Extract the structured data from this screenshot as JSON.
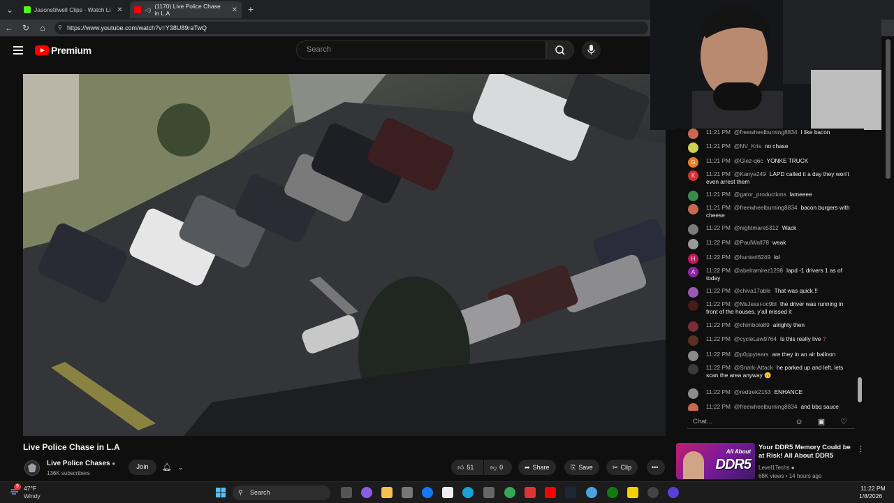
{
  "browser": {
    "tabs": [
      {
        "label": "Jasonstilwell Clips - Watch Li",
        "color": "#53fc18"
      },
      {
        "label": "(1170) Live Police Chase in L.A",
        "color": "#ff0000"
      }
    ],
    "new_tab": "+",
    "url": "https://www.youtube.com/watch?v=Y38U89raTwQ"
  },
  "youtube": {
    "logo_text": "Premium",
    "search_placeholder": "Search"
  },
  "video": {
    "title": "Live Police Chase in L.A",
    "channel": "Live Police Chases",
    "subscribers": "136K subscribers",
    "join_label": "Join",
    "likes": "51",
    "dislikes": "0",
    "share_label": "Share",
    "save_label": "Save",
    "clip_label": "Clip"
  },
  "chat": {
    "messages": [
      {
        "time": "11:21 PM",
        "author": "@freewheelburning8834",
        "text": "I like bacon",
        "avatar_color": "#c7684f"
      },
      {
        "time": "11:21 PM",
        "author": "@NV_Kris",
        "text": "no chase",
        "avatar_color": "#cbd44b"
      },
      {
        "time": "11:21 PM",
        "author": "@Glez-q6c",
        "text": "YONKE TRUCK",
        "avatar_color": "#e67e22",
        "initial": "G"
      },
      {
        "time": "11:21 PM",
        "author": "@Kanye249",
        "text": "LAPD called it a day they won't even arrest them",
        "avatar_color": "#d63031",
        "initial": "K"
      },
      {
        "time": "11:21 PM",
        "author": "@gator_productions",
        "text": "lameeee",
        "avatar_color": "#3c8a4a"
      },
      {
        "time": "11:21 PM",
        "author": "@freewheelburning8834",
        "text": "bacon burgers with cheese",
        "avatar_color": "#c7684f"
      },
      {
        "time": "11:22 PM",
        "author": "@nightmare5312",
        "text": "Wack",
        "avatar_color": "#7a7a7a"
      },
      {
        "time": "11:22 PM",
        "author": "@PaulWall78",
        "text": "weak",
        "avatar_color": "#9a9a9a"
      },
      {
        "time": "11:22 PM",
        "author": "@hunterl6249",
        "text": "lol",
        "avatar_color": "#c2185b",
        "initial": "H"
      },
      {
        "time": "11:22 PM",
        "author": "@abelramirez1298",
        "text": "lapd -1 drivers 1 as of today",
        "avatar_color": "#8e24aa",
        "initial": "A"
      },
      {
        "time": "11:22 PM",
        "author": "@chiva17able",
        "text": "That was quick.!!",
        "avatar_color": "#9b59b6"
      },
      {
        "time": "11:22 PM",
        "author": "@MsJessi-oc9bl",
        "text": "the driver was running in front of the houses. y'all missed it",
        "avatar_color": "#4a1a1a"
      },
      {
        "time": "11:22 PM",
        "author": "@chimbolo89",
        "text": "alrighty then",
        "avatar_color": "#7b2d3a"
      },
      {
        "time": "11:22 PM",
        "author": "@cycleLaw9764",
        "text": "Is this really live",
        "avatar_color": "#5a3020",
        "emoji": "?"
      },
      {
        "time": "11:22 PM",
        "author": "@p0ppytears",
        "text": "are they in an air balloon",
        "avatar_color": "#8a8a8a"
      },
      {
        "time": "11:22 PM",
        "author": "@Snark-Attack",
        "text": "he parked up and left, lets scan the area anyway",
        "avatar_color": "#3a3a3a",
        "emoji": "🙃"
      },
      {
        "time": "11:22 PM",
        "author": "@redtrek2153",
        "text": "ENHANCE",
        "avatar_color": "#8d8d8d"
      },
      {
        "time": "11:22 PM",
        "author": "@freewheelburning8834",
        "text": "and bbq sauce",
        "avatar_color": "#c7684f"
      }
    ],
    "input_placeholder": "Chat..."
  },
  "recommendation": {
    "title": "Your DDR5 Memory Could be at Risk! All About DDR5",
    "channel": "Level1Techs",
    "meta": "68K views • 14 hours ago",
    "thumb_line1": "All About",
    "thumb_line2": "DDR5"
  },
  "taskbar": {
    "temperature": "47°F",
    "weather": "Windy",
    "search_label": "Search",
    "time": "11:22 PM",
    "date": "1/8/2026",
    "notification_count": "9"
  }
}
